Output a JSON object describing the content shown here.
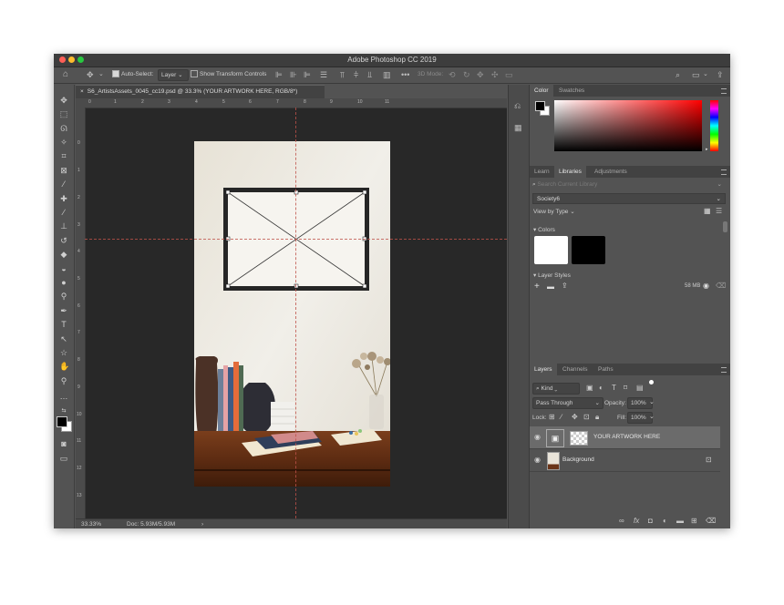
{
  "app": {
    "title": "Adobe Photoshop CC 2019"
  },
  "options_bar": {
    "auto_select_label": "Auto-Select:",
    "auto_select_value": "Layer",
    "show_transform_label": "Show Transform Controls",
    "mode_3d_label": "3D Mode:"
  },
  "document": {
    "tab_title": "S6_ArtistsAssets_0045_cc19.psd @ 33.3% (YOUR ARTWORK HERE, RGB/8*)",
    "ruler_h": [
      "0",
      "1",
      "2",
      "3",
      "4",
      "5",
      "6",
      "7",
      "8",
      "9",
      "10",
      "11"
    ],
    "ruler_v": [
      "0",
      "1",
      "2",
      "3",
      "4",
      "5",
      "6",
      "7",
      "8",
      "9",
      "10",
      "11",
      "12",
      "13"
    ]
  },
  "status": {
    "zoom": "33.33%",
    "doc_size": "Doc: 5.93M/5.93M"
  },
  "color_panel": {
    "tabs": [
      "Color",
      "Swatches"
    ],
    "active_tab": "Color",
    "hue_color": "#ff0000"
  },
  "libraries_panel": {
    "tabs": [
      "Learn",
      "Libraries",
      "Adjustments"
    ],
    "active_tab": "Libraries",
    "search_placeholder": "Search Current Library",
    "library_name": "Society6",
    "view_by": "View by Type",
    "colors_header": "Colors",
    "swatch_colors": [
      "#ffffff",
      "#000000"
    ],
    "layer_styles_header": "Layer Styles",
    "storage": "58 MB"
  },
  "layers_panel": {
    "tabs": [
      "Layers",
      "Channels",
      "Paths"
    ],
    "active_tab": "Layers",
    "filter_kind": "Kind",
    "blend_mode": "Pass Through",
    "opacity_label": "Opacity:",
    "opacity_value": "100%",
    "lock_label": "Lock:",
    "fill_label": "Fill:",
    "fill_value": "100%",
    "layers": [
      {
        "name": "YOUR ARTWORK HERE",
        "selected": true
      },
      {
        "name": "Background",
        "selected": false,
        "locked": true
      }
    ]
  }
}
